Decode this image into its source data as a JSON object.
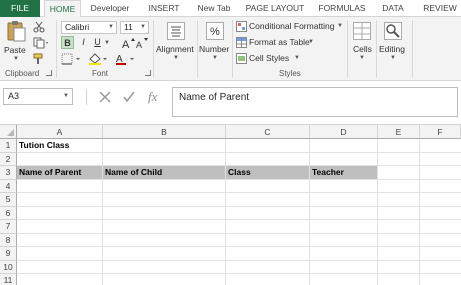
{
  "tabs": [
    "FILE",
    "HOME",
    "Developer",
    "INSERT",
    "New Tab",
    "PAGE LAYOUT",
    "FORMULAS",
    "DATA",
    "REVIEW"
  ],
  "ribbon": {
    "clipboard": {
      "paste_label": "Paste",
      "group_label": "Clipboard"
    },
    "font": {
      "font_name": "Calibri",
      "font_size": "11",
      "group_label": "Font",
      "bold": "B",
      "italic": "I",
      "underline": "U"
    },
    "alignment_label": "Alignment",
    "number_label": "Number",
    "styles": {
      "conditional_formatting": "Conditional Formatting",
      "format_as_table": "Format as Table",
      "cell_styles": "Cell Styles",
      "group_label": "Styles"
    },
    "cells_label": "Cells",
    "editing_label": "Editing"
  },
  "formula_bar": {
    "name_box": "A3",
    "formula": "Name of Parent",
    "fx": "fx"
  },
  "sheet": {
    "columns": [
      "A",
      "B",
      "C",
      "D",
      "E",
      "F"
    ],
    "rows": [
      "1",
      "2",
      "3",
      "4",
      "5",
      "6",
      "7",
      "8",
      "9",
      "10",
      "11"
    ],
    "cells": {
      "A1": "Tution Class",
      "A3": "Name of Parent",
      "B3": "Name of Child",
      "C3": "Class",
      "D3": "Teacher"
    },
    "header_fill": "#bfbfbf",
    "accent": "#217346"
  }
}
